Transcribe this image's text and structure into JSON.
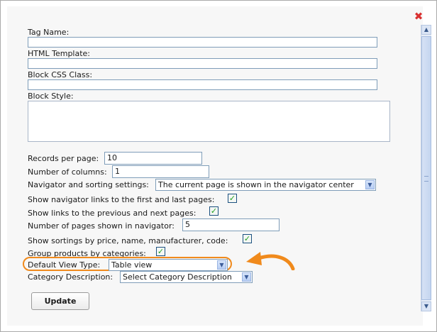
{
  "dialog": {
    "close_glyph": "✖",
    "accent_color": "#f08a1c"
  },
  "form": {
    "tag_name": {
      "label": "Tag Name:",
      "value": ""
    },
    "html_template": {
      "label": "HTML Template:",
      "value": ""
    },
    "block_css_class": {
      "label": "Block CSS Class:",
      "value": ""
    },
    "block_style": {
      "label": "Block Style:",
      "value": ""
    },
    "records_per_page": {
      "label": "Records per page:",
      "value": "10"
    },
    "number_of_columns": {
      "label": "Number of columns:",
      "value": "1"
    },
    "navigator_settings": {
      "label": "Navigator and sorting settings:",
      "selected": "The current page is shown in the navigator center"
    },
    "show_first_last": {
      "label": "Show navigator links to the first and last pages:",
      "checked": true
    },
    "show_prev_next": {
      "label": "Show links to the previous and next pages:",
      "checked": true
    },
    "pages_in_navigator": {
      "label": "Number of pages shown in navigator:",
      "value": "5"
    },
    "show_sortings": {
      "label": "Show sortings by price, name, manufacturer, code:",
      "checked": true
    },
    "group_by_categories": {
      "label": "Group products by categories:",
      "checked": true
    },
    "default_view_type": {
      "label": "Default View Type:",
      "selected": "Table view"
    },
    "category_description": {
      "label": "Category Description:",
      "selected": "Select Category Description"
    }
  },
  "actions": {
    "update_label": "Update"
  },
  "icons": {
    "check": "✓",
    "dropdown": "▼",
    "scroll_up": "▲",
    "scroll_down": "▼"
  }
}
